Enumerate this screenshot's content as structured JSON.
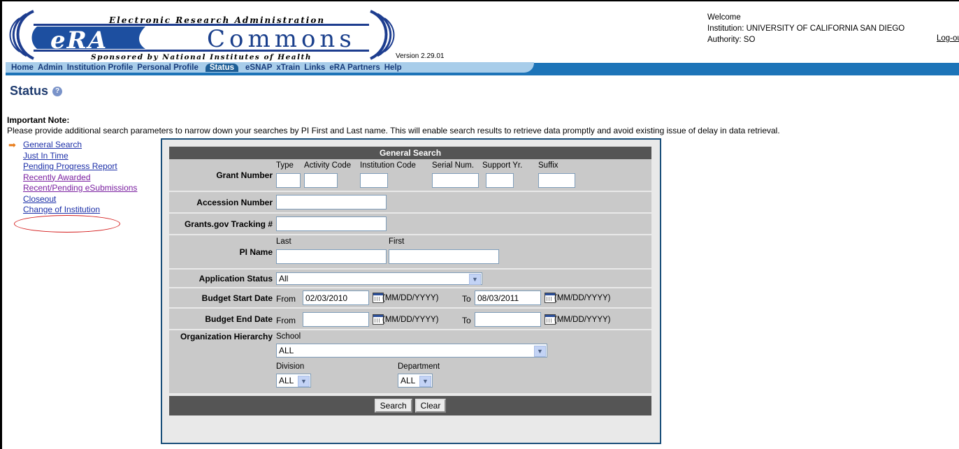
{
  "header": {
    "logo_tag_top": "Electronic Research Administration",
    "logo_era": "eRA",
    "logo_commons": "Commons",
    "logo_tag_bottom": "Sponsored by National Institutes of Health",
    "version": "Version 2.29.01"
  },
  "nav": {
    "items": [
      "Home",
      "Admin",
      "Institution Profile",
      "Personal Profile",
      "Status",
      "eSNAP",
      "xTrain",
      "Links",
      "eRA Partners",
      "Help"
    ],
    "active": "Status"
  },
  "welcome": {
    "line1": "Welcome",
    "institution": "Institution: UNIVERSITY OF CALIFORNIA SAN DIEGO",
    "authority": "Authority:  SO",
    "logout": "Log-out"
  },
  "page": {
    "title": "Status",
    "note_title": "Important Note:",
    "note_text": "Please provide additional search parameters to narrow down your searches by PI First and Last name. This will enable search results to retrieve data promptly and avoid existing issue of delay in data retrieval."
  },
  "left_nav": {
    "items": [
      "General Search",
      "Just In Time",
      "Pending Progress Report",
      "Recently Awarded",
      "Recent/Pending eSubmissions",
      "Closeout",
      "Change of Institution"
    ]
  },
  "search": {
    "header": "General Search",
    "grant_number_label": "Grant Number",
    "grant_cols": [
      "Type",
      "Activity Code",
      "Institution Code",
      "Serial Num.",
      "Support Yr.",
      "Suffix"
    ],
    "accession_label": "Accession Number",
    "grantsgov_label": "Grants.gov Tracking #",
    "pi_name_label": "PI Name",
    "pi_last": "Last",
    "pi_first": "First",
    "app_status_label": "Application Status",
    "app_status_value": "All",
    "budget_start_label": "Budget Start Date",
    "budget_end_label": "Budget End Date",
    "from": "From",
    "to": "To",
    "date_format": "(MM/DD/YYYY)",
    "budget_start_from": "02/03/2010",
    "budget_start_to": "08/03/2011",
    "budget_end_from": "",
    "budget_end_to": "",
    "org_label": "Organization Hierarchy",
    "school_label": "School",
    "school_value": "ALL",
    "division_label": "Division",
    "division_value": "ALL",
    "department_label": "Department",
    "department_value": "ALL",
    "search_button": "Search",
    "clear_button": "Clear"
  }
}
